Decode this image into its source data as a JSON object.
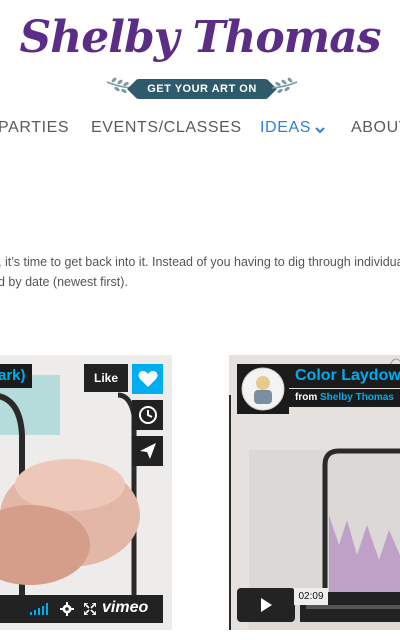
{
  "brand": {
    "title": "Shelby Thomas",
    "tagline": "GET YOUR ART ON",
    "colors": {
      "purple": "#5b2d86",
      "teal": "#2e5a6b",
      "sprig": "#7a9aa5"
    }
  },
  "nav": {
    "items": [
      {
        "label": "PARTIES"
      },
      {
        "label": "EVENTS/CLASSES"
      },
      {
        "label": "IDEAS",
        "active": true,
        "icon": "chevron-down-icon"
      },
      {
        "label": "ABOUT"
      }
    ],
    "colors": {
      "normal": "#5a5a5a",
      "active": "#2e7fe0"
    }
  },
  "intro": {
    "line1": ", it’s time to get back into it. Instead of you having to dig through individual",
    "line2": "d by date (newest first)."
  },
  "videos": [
    {
      "title": "ark)",
      "like_label": "Like",
      "side_icons": [
        "heart-icon",
        "clock-icon",
        "send-icon"
      ],
      "player_brand": "vimeo",
      "controls": [
        "volume-bars-icon",
        "gear-icon",
        "fullscreen-icon"
      ]
    },
    {
      "title": "Color Laydow",
      "byline_prefix": "from",
      "byline_author": "Shelby Thomas",
      "time": "02:09",
      "controls": [
        "play-icon"
      ]
    }
  ],
  "colors": {
    "vimeo_blue": "#00adef",
    "player_dark": "#222222"
  }
}
